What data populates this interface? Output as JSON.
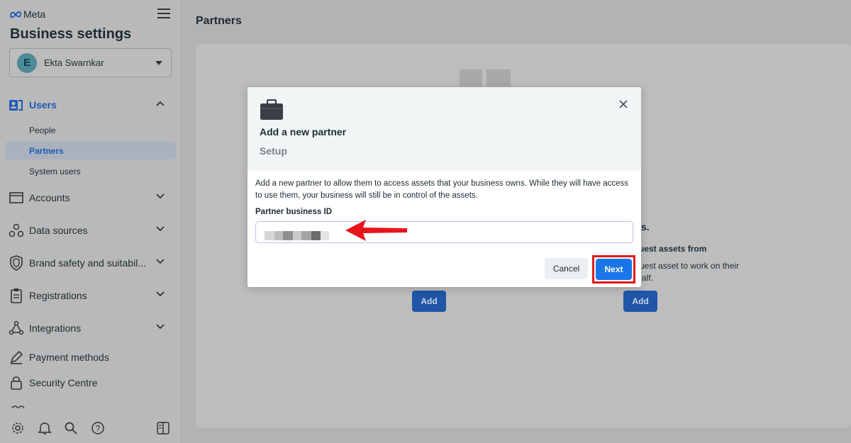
{
  "app": {
    "brand": "Meta",
    "title": "Business settings"
  },
  "account": {
    "initial": "E",
    "name": "Ekta Swarnkar"
  },
  "sidebar": {
    "users": {
      "label": "Users",
      "children": [
        "People",
        "Partners",
        "System users"
      ]
    },
    "items": [
      {
        "label": "Accounts",
        "icon": "folder-icon"
      },
      {
        "label": "Data sources",
        "icon": "data-sources-icon"
      },
      {
        "label": "Brand safety and suitabil...",
        "icon": "shield-icon"
      },
      {
        "label": "Registrations",
        "icon": "clipboard-icon"
      },
      {
        "label": "Integrations",
        "icon": "integrations-icon"
      },
      {
        "label": "Payment methods",
        "icon": "pen-icon"
      },
      {
        "label": "Security Centre",
        "icon": "lock-icon"
      }
    ],
    "active_child": "Partners",
    "bottom_icons": [
      "gear-icon",
      "bell-icon",
      "search-icon",
      "help-icon",
      "panel-toggle-icon"
    ]
  },
  "main": {
    "page_title": "Partners",
    "bg_heading_fragment": "s.",
    "bg_subheading_fragment": "uest assets from",
    "bg_text_fragment_1": "uest asset to work on their",
    "bg_text_fragment_2": "alf.",
    "add_label": "Add"
  },
  "dialog": {
    "title": "Add a new partner",
    "subtitle": "Setup",
    "description": "Add a new partner to allow them to access assets that your business owns. While they will have access to use them, your business will still be in control of the assets.",
    "field_label": "Partner business ID",
    "cancel_label": "Cancel",
    "next_label": "Next"
  },
  "colors": {
    "primary": "#1a76e8",
    "active_nav": "#1d5bb5",
    "highlight_box": "#e3191b",
    "arrow": "#e8141c"
  }
}
